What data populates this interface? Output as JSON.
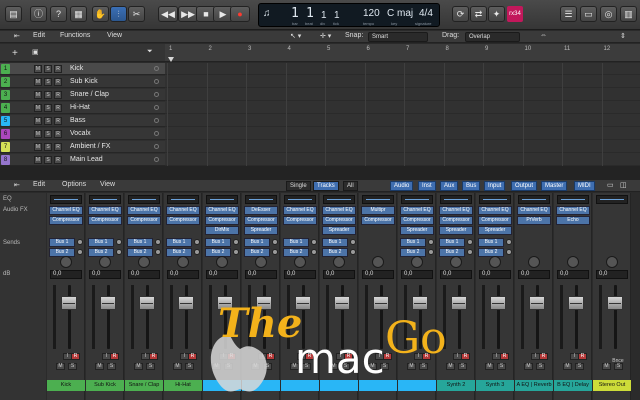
{
  "transport": {
    "lcd": {
      "bar": "1",
      "beat": "1",
      "div": "1",
      "tick": "1",
      "tempo": "120",
      "key": "C maj",
      "sig": "4/4",
      "cap_bar": "bar",
      "cap_beat": "beat",
      "cap_div": "div",
      "cap_tick": "tick",
      "cap_tempo": "tempo",
      "cap_key": "key",
      "cap_sig": "signature"
    },
    "cpu_badge": "rx34"
  },
  "tracks_toolbar": {
    "edit": "Edit",
    "functions": "Functions",
    "view": "View",
    "snap_label": "Snap:",
    "snap_value": "Smart",
    "drag_label": "Drag:",
    "drag_value": "Overlap"
  },
  "ruler": [
    "1",
    "2",
    "3",
    "4",
    "5",
    "6",
    "7",
    "8",
    "9",
    "10",
    "11",
    "12"
  ],
  "tracks": [
    {
      "num": "1",
      "name": "Kick",
      "color": "#4caf50",
      "selected": true
    },
    {
      "num": "2",
      "name": "Sub Kick",
      "color": "#4caf50",
      "selected": false
    },
    {
      "num": "3",
      "name": "Snare / Clap",
      "color": "#4caf50",
      "selected": false
    },
    {
      "num": "4",
      "name": "Hi-Hat",
      "color": "#4caf50",
      "selected": false
    },
    {
      "num": "5",
      "name": "Bass",
      "color": "#29b6f6",
      "selected": false
    },
    {
      "num": "6",
      "name": "Vocalx",
      "color": "#ab47bc",
      "selected": false
    },
    {
      "num": "7",
      "name": "Ambient / FX",
      "color": "#d4e157",
      "selected": false
    },
    {
      "num": "8",
      "name": "Main Lead",
      "color": "#9575cd",
      "selected": false
    }
  ],
  "track_buttons": {
    "mute": "M",
    "solo": "S",
    "rec": "R"
  },
  "mixer_toolbar": {
    "edit": "Edit",
    "options": "Options",
    "view": "View",
    "modes": [
      "Single",
      "Tracks",
      "All"
    ],
    "active_mode": "Tracks",
    "filters": [
      "Audio",
      "Inst",
      "Aux",
      "Bus",
      "Input",
      "Output",
      "Master",
      "MIDI"
    ]
  },
  "mixer_labels": {
    "eq": "EQ",
    "audio_fx": "Audio FX",
    "sends": "Sends",
    "db": "dB"
  },
  "strips": [
    {
      "name": "Kick",
      "color": "#4caf50",
      "fx": [
        "Channel EQ",
        "Compressor"
      ],
      "sends": [
        "Bus 1",
        "Bus 2"
      ],
      "db": "0,0",
      "level": 0.72
    },
    {
      "name": "Sub Kick",
      "color": "#4caf50",
      "fx": [
        "Channel EQ",
        "Compressor"
      ],
      "sends": [
        "Bus 1",
        "Bus 2"
      ],
      "db": "0,0",
      "level": 0.72
    },
    {
      "name": "Snare / Clap",
      "color": "#4caf50",
      "fx": [
        "Channel EQ",
        "Compressor"
      ],
      "sends": [
        "Bus 1",
        "Bus 2"
      ],
      "db": "0,0",
      "level": 0.72
    },
    {
      "name": "Hi-Hat",
      "color": "#4caf50",
      "fx": [
        "Channel EQ",
        "Compressor"
      ],
      "sends": [
        "Bus 1",
        "Bus 2"
      ],
      "db": "0,0",
      "level": 0.72
    },
    {
      "name": "",
      "color": "#29b6f6",
      "fx": [
        "Channel EQ",
        "Compressor",
        "DirMix"
      ],
      "sends": [
        "Bus 1",
        "Bus 2"
      ],
      "db": "0,0",
      "level": 0.72
    },
    {
      "name": "",
      "color": "#29b6f6",
      "fx": [
        "DeEsser",
        "Compressor",
        "Spreader"
      ],
      "sends": [
        "Bus 1",
        "Bus 2"
      ],
      "db": "0,0",
      "level": 0.72
    },
    {
      "name": "",
      "color": "#29b6f6",
      "fx": [
        "Channel EQ",
        "Compressor"
      ],
      "sends": [
        "Bus 1",
        "Bus 2"
      ],
      "db": "0,0",
      "level": 0.72
    },
    {
      "name": "",
      "color": "#29b6f6",
      "fx": [
        "Channel EQ",
        "Compressor",
        "Spreader"
      ],
      "sends": [
        "Bus 1",
        "Bus 2"
      ],
      "db": "0,0",
      "level": 0.72
    },
    {
      "name": "",
      "color": "#29b6f6",
      "fx": [
        "Multipr",
        "Compressor"
      ],
      "sends": [],
      "db": "0,0",
      "level": 0.72
    },
    {
      "name": "",
      "color": "#29b6f6",
      "fx": [
        "Channel EQ",
        "Compressor",
        "Spreader"
      ],
      "sends": [
        "Bus 1",
        "Bus 2"
      ],
      "db": "0,0",
      "level": 0.72
    },
    {
      "name": "Synth 2",
      "color": "#26a69a",
      "fx": [
        "Channel EQ",
        "Compressor",
        "Spreader"
      ],
      "sends": [
        "Bus 1",
        "Bus 2"
      ],
      "db": "0,0",
      "level": 0.72
    },
    {
      "name": "Synth 3",
      "color": "#26a69a",
      "fx": [
        "Channel EQ",
        "Compressor",
        "Spreader"
      ],
      "sends": [
        "Bus 1",
        "Bus 2"
      ],
      "db": "0,0",
      "level": 0.72
    },
    {
      "name": "A EQ | Reverb",
      "color": "#26a69a",
      "fx": [
        "Channel EQ",
        "PrVerb"
      ],
      "sends": [],
      "db": "0,0",
      "level": 0.72
    },
    {
      "name": "B EQ | Delay",
      "color": "#26a69a",
      "fx": [
        "Channel EQ",
        "Echo"
      ],
      "sends": [],
      "db": "0,0",
      "level": 0.72
    },
    {
      "name": "Stereo Out",
      "color": "#cddc39",
      "fx": [],
      "sends": [],
      "db": "0,0",
      "level": 0.72,
      "bnce": "Bnce"
    }
  ],
  "strip_buttons": {
    "mute": "M",
    "solo": "S",
    "rec": "R",
    "input": "I"
  },
  "watermark": {
    "text_a": "The",
    "text_b": "mac",
    "text_c": "Go"
  },
  "colors": {
    "accent_blue": "#3f6eb0",
    "rec_red": "#ff3b30",
    "yellow": "#f3b21b"
  }
}
